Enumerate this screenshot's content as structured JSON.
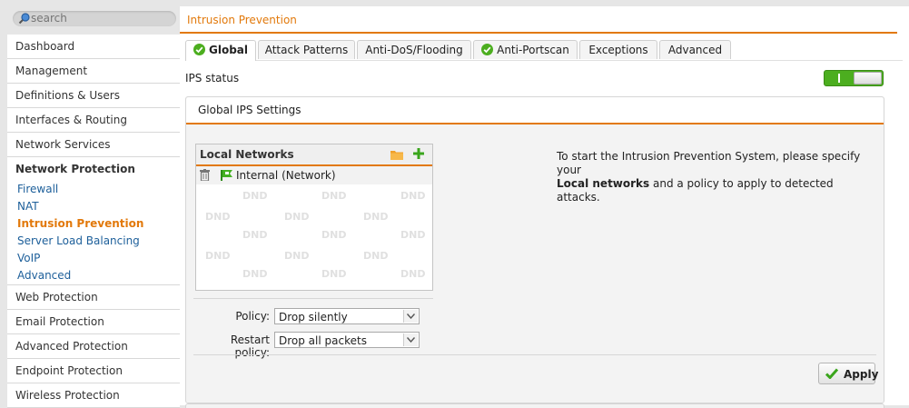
{
  "search": {
    "placeholder": "search"
  },
  "sidebar": {
    "items_top": [
      "Dashboard",
      "Management",
      "Definitions & Users",
      "Interfaces & Routing",
      "Network Services"
    ],
    "active_section": "Network Protection",
    "sub_items": [
      "Firewall",
      "NAT",
      "Intrusion Prevention",
      "Server Load Balancing",
      "VoIP",
      "Advanced"
    ],
    "current_sub_item": "Intrusion Prevention",
    "items_bottom": [
      "Web Protection",
      "Email Protection",
      "Advanced Protection",
      "Endpoint Protection",
      "Wireless Protection"
    ]
  },
  "page": {
    "title": "Intrusion Prevention"
  },
  "tabs": [
    {
      "label": "Global",
      "selected": true,
      "check": true
    },
    {
      "label": "Attack Patterns",
      "selected": false,
      "check": false
    },
    {
      "label": "Anti-DoS/Flooding",
      "selected": false,
      "check": false
    },
    {
      "label": "Anti-Portscan",
      "selected": false,
      "check": true
    },
    {
      "label": "Exceptions",
      "selected": false,
      "check": false
    },
    {
      "label": "Advanced",
      "selected": false,
      "check": false
    }
  ],
  "ips_status": {
    "label": "IPS status",
    "enabled": true
  },
  "panel": {
    "title": "Global IPS Settings",
    "local_networks": {
      "title": "Local Networks",
      "entries": [
        "Internal (Network)"
      ],
      "watermark": "DND"
    },
    "policy": {
      "label": "Policy:",
      "value": "Drop silently"
    },
    "restart_policy": {
      "label": "Restart policy:",
      "value": "Drop all packets"
    },
    "info_text_1": "To start the Intrusion Prevention System, please specify your",
    "info_bold": "Local networks",
    "info_text_2": " and a policy to apply to detected attacks.",
    "apply_label": "Apply"
  },
  "colors": {
    "accent": "#e2790b",
    "link": "#1d5f9a",
    "toggle_on": "#4cae1f"
  }
}
